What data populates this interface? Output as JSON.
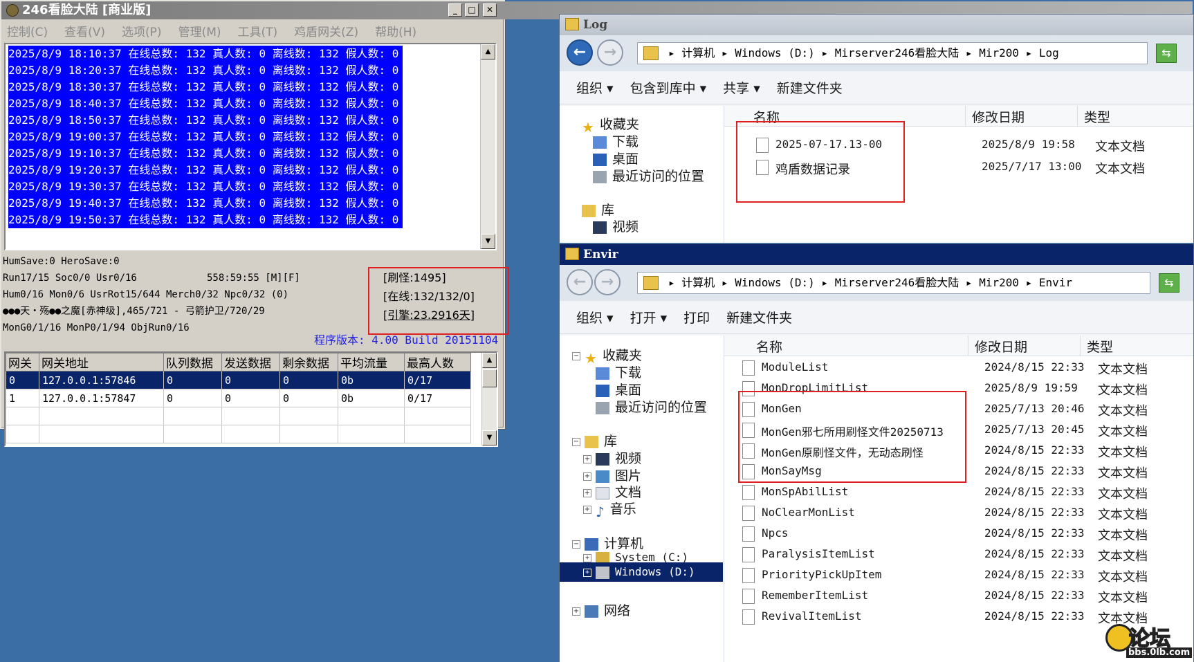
{
  "server": {
    "title": "246看脸大陆 [商业版]",
    "menu": [
      "控制(C)",
      "查看(V)",
      "选项(P)",
      "管理(M)",
      "工具(T)",
      "鸡盾网关(Z)",
      "帮助(H)"
    ],
    "log_lines": [
      "2025/8/9 18:10:37 在线总数: 132 真人数: 0 离线数: 132 假人数: 0",
      "2025/8/9 18:20:37 在线总数: 132 真人数: 0 离线数: 132 假人数: 0",
      "2025/8/9 18:30:37 在线总数: 132 真人数: 0 离线数: 132 假人数: 0",
      "2025/8/9 18:40:37 在线总数: 132 真人数: 0 离线数: 132 假人数: 0",
      "2025/8/9 18:50:37 在线总数: 132 真人数: 0 离线数: 132 假人数: 0",
      "2025/8/9 19:00:37 在线总数: 132 真人数: 0 离线数: 132 假人数: 0",
      "2025/8/9 19:10:37 在线总数: 132 真人数: 0 离线数: 132 假人数: 0",
      "2025/8/9 19:20:37 在线总数: 132 真人数: 0 离线数: 132 假人数: 0",
      "2025/8/9 19:30:37 在线总数: 132 真人数: 0 离线数: 132 假人数: 0",
      "2025/8/9 19:40:37 在线总数: 132 真人数: 0 离线数: 132 假人数: 0",
      "2025/8/9 19:50:37 在线总数: 132 真人数: 0 离线数: 132 假人数: 0"
    ],
    "status_lines": [
      "HumSave:0 HeroSave:0",
      "Run17/15 Soc0/0 Usr0/16            558:59:55 [M][F]",
      "Hum0/16 Mon0/6 UsrRot15/644 Merch0/32 Npc0/32 (0)",
      "●●●天・殇●●之魔[赤神级],465/721 - 弓箭护卫/720/29",
      "MonG0/1/16 MonP0/1/94 ObjRun0/16"
    ],
    "info_box": [
      "[刷怪:1495]",
      "[在线:132/132/0]",
      "[引擎:23.2916天]"
    ],
    "version": "程序版本: 4.00 Build 20151104",
    "grid_headers": [
      "网关",
      "网关地址",
      "队列数据",
      "发送数据",
      "剩余数据",
      "平均流量",
      "最高人数"
    ],
    "grid_rows": [
      [
        "0",
        "127.0.0.1:57846",
        "0",
        "0",
        "0",
        "0b",
        "0/17"
      ],
      [
        "1",
        "127.0.0.1:57847",
        "0",
        "0",
        "0",
        "0b",
        "0/17"
      ]
    ]
  },
  "log_window": {
    "title": "Log",
    "address": [
      "计算机",
      "Windows (D:)",
      "Mirserver246看脸大陆",
      "Mir200",
      "Log"
    ],
    "commands": [
      "组织 ▾",
      "包含到库中 ▾",
      "共享 ▾",
      "新建文件夹"
    ],
    "nav": [
      "收藏夹",
      "下载",
      "桌面",
      "最近访问的位置",
      "库",
      "视频"
    ],
    "columns": [
      "名称",
      "修改日期",
      "类型"
    ],
    "files": [
      {
        "name": "2025-07-17.13-00",
        "date": "2025/8/9 19:58",
        "type": "文本文档"
      },
      {
        "name": "鸡盾数据记录",
        "date": "2025/7/17 13:00",
        "type": "文本文档"
      }
    ]
  },
  "envir_window": {
    "title": "Envir",
    "address": [
      "计算机",
      "Windows (D:)",
      "Mirserver246看脸大陆",
      "Mir200",
      "Envir"
    ],
    "commands": [
      "组织 ▾",
      "打开 ▾",
      "打印",
      "新建文件夹"
    ],
    "nav": [
      "收藏夹",
      "下载",
      "桌面",
      "最近访问的位置",
      "库",
      "视频",
      "图片",
      "文档",
      "音乐",
      "计算机",
      "System (C:)",
      "Windows (D:)",
      "网络"
    ],
    "columns": [
      "名称",
      "修改日期",
      "类型"
    ],
    "files": [
      {
        "name": "ModuleList",
        "date": "2024/8/15 22:33",
        "type": "文本文档"
      },
      {
        "name": "MonDropLimitList",
        "date": "2025/8/9 19:59",
        "type": "文本文档"
      },
      {
        "name": "MonGen",
        "date": "2025/7/13 20:46",
        "type": "文本文档"
      },
      {
        "name": "MonGen邪七所用刷怪文件20250713",
        "date": "2025/7/13 20:45",
        "type": "文本文档"
      },
      {
        "name": "MonGen原刷怪文件，无动态刷怪",
        "date": "2024/8/15 22:33",
        "type": "文本文档"
      },
      {
        "name": "MonSayMsg",
        "date": "2024/8/15 22:33",
        "type": "文本文档"
      },
      {
        "name": "MonSpAbilList",
        "date": "2024/8/15 22:33",
        "type": "文本文档"
      },
      {
        "name": "NoClearMonList",
        "date": "2024/8/15 22:33",
        "type": "文本文档"
      },
      {
        "name": "Npcs",
        "date": "2024/8/15 22:33",
        "type": "文本文档"
      },
      {
        "name": "ParalysisItemList",
        "date": "2024/8/15 22:33",
        "type": "文本文档"
      },
      {
        "name": "PriorityPickUpItem",
        "date": "2024/8/15 22:33",
        "type": "文本文档"
      },
      {
        "name": "RememberItemList",
        "date": "2024/8/15 22:33",
        "type": "文本文档"
      },
      {
        "name": "RevivalItemList",
        "date": "2024/8/15 22:33",
        "type": "文本文档"
      }
    ]
  },
  "watermark": {
    "text": "论坛",
    "url": "bbs.0lb.com"
  }
}
